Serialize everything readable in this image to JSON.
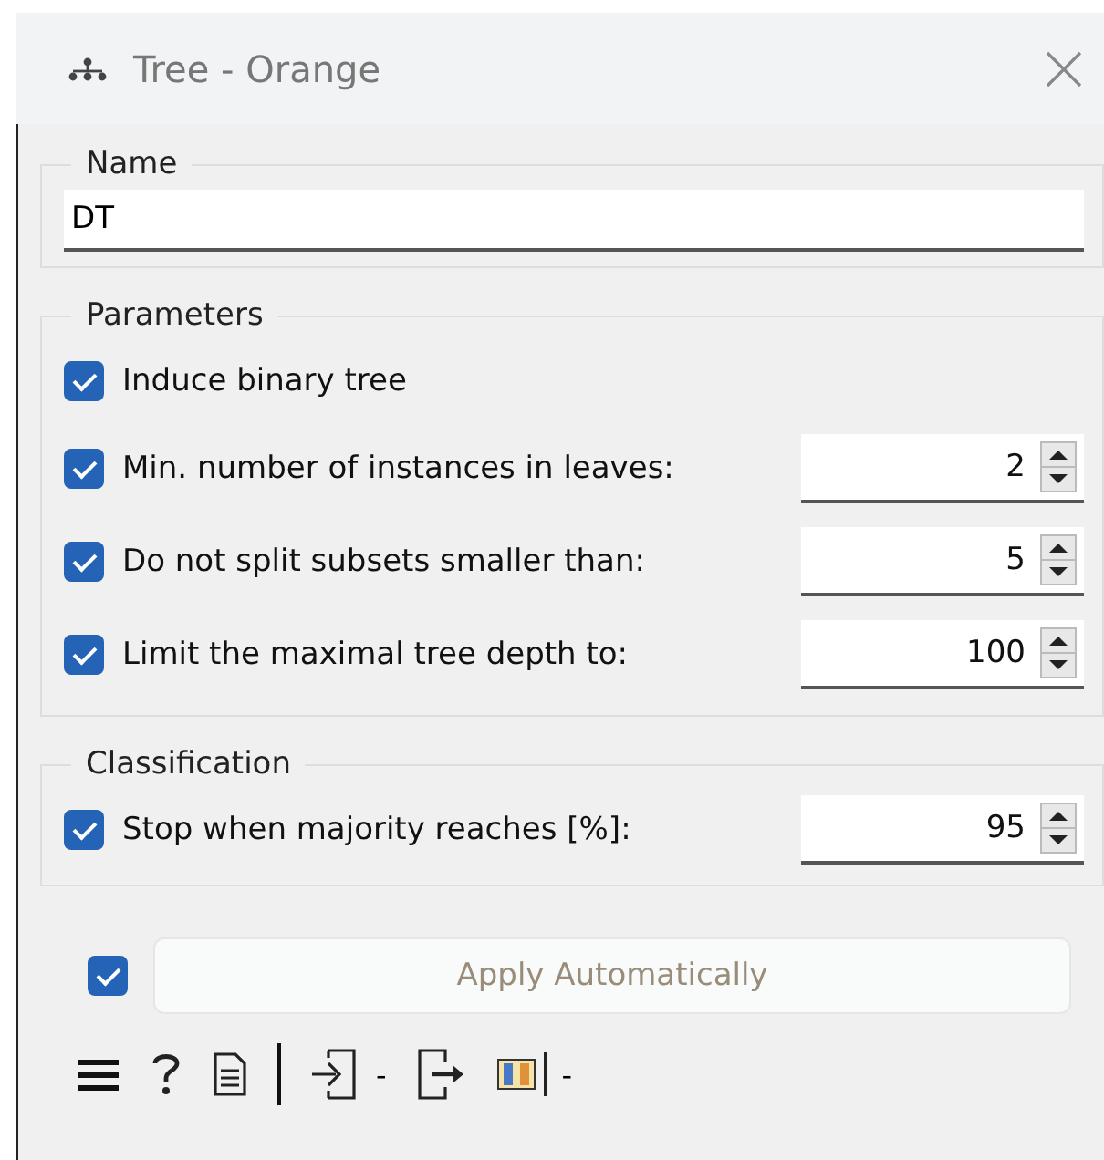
{
  "window": {
    "title": "Tree - Orange"
  },
  "name_group": {
    "title": "Name",
    "value": "DT"
  },
  "groups": [
    {
      "title": "Parameters",
      "options": [
        {
          "kind": "check",
          "label": "Induce binary tree",
          "checked": true
        },
        {
          "kind": "spin",
          "label": "Min. number of instances in leaves:",
          "checked": true,
          "value": "2"
        },
        {
          "kind": "spin",
          "label": "Do not split subsets smaller than:",
          "checked": true,
          "value": "5"
        },
        {
          "kind": "spin",
          "label": "Limit the maximal tree depth to:",
          "checked": true,
          "value": "100"
        }
      ]
    },
    {
      "title": "Classification",
      "options": [
        {
          "kind": "spin",
          "label": "Stop when majority reaches [%]:",
          "checked": true,
          "value": "95"
        }
      ]
    }
  ],
  "apply": {
    "checked": true,
    "label": "Apply Automatically",
    "disabled": true
  },
  "toolbar": {
    "input_count": "-",
    "output_count": "-"
  }
}
